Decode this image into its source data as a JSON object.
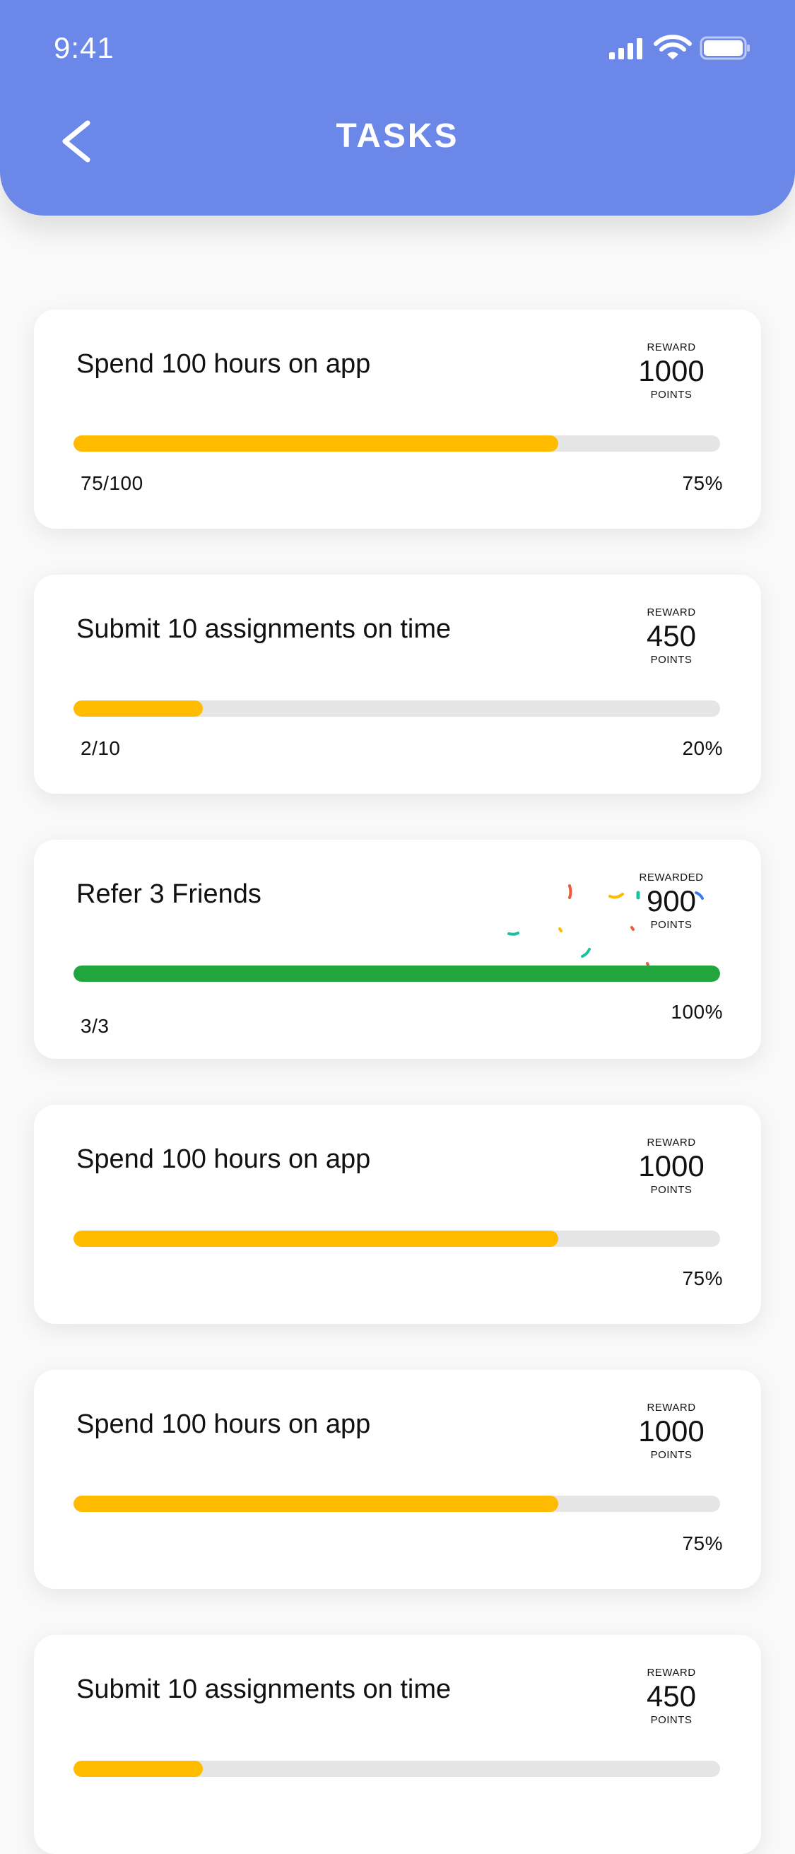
{
  "status_bar": {
    "time": "9:41"
  },
  "header": {
    "title": "TASKS",
    "back_icon": "chevron-left-icon"
  },
  "colors": {
    "header_bg": "#6b88e8",
    "progress_in_progress": "#ffbb00",
    "progress_complete": "#21a63e",
    "progress_track": "#e5e5e5"
  },
  "tasks": [
    {
      "title": "Spend 100 hours on app",
      "reward_label": "REWARD",
      "reward_value": "1000",
      "reward_unit": "POINTS",
      "progress_text": "75/100",
      "percent_text": "75%",
      "progress": 0.75,
      "completed": false
    },
    {
      "title": "Submit 10 assignments on time",
      "reward_label": "REWARD",
      "reward_value": "450",
      "reward_unit": "POINTS",
      "progress_text": "2/10",
      "percent_text": "20%",
      "progress": 0.2,
      "completed": false
    },
    {
      "title": "Refer 3 Friends",
      "reward_label": "REWARDED",
      "reward_value": "900",
      "reward_unit": "POINTS",
      "progress_text": "3/3",
      "percent_text": "100%",
      "progress": 1.0,
      "completed": true
    },
    {
      "title": "Spend 100 hours on app",
      "reward_label": "REWARD",
      "reward_value": "1000",
      "reward_unit": "POINTS",
      "progress_text": "",
      "percent_text": "75%",
      "progress": 0.75,
      "completed": false
    },
    {
      "title": "Spend 100 hours on app",
      "reward_label": "REWARD",
      "reward_value": "1000",
      "reward_unit": "POINTS",
      "progress_text": "",
      "percent_text": "75%",
      "progress": 0.75,
      "completed": false
    },
    {
      "title": "Submit 10 assignments on time",
      "reward_label": "REWARD",
      "reward_value": "450",
      "reward_unit": "POINTS",
      "progress_text": "",
      "percent_text": "",
      "progress": 0.2,
      "completed": false
    }
  ]
}
